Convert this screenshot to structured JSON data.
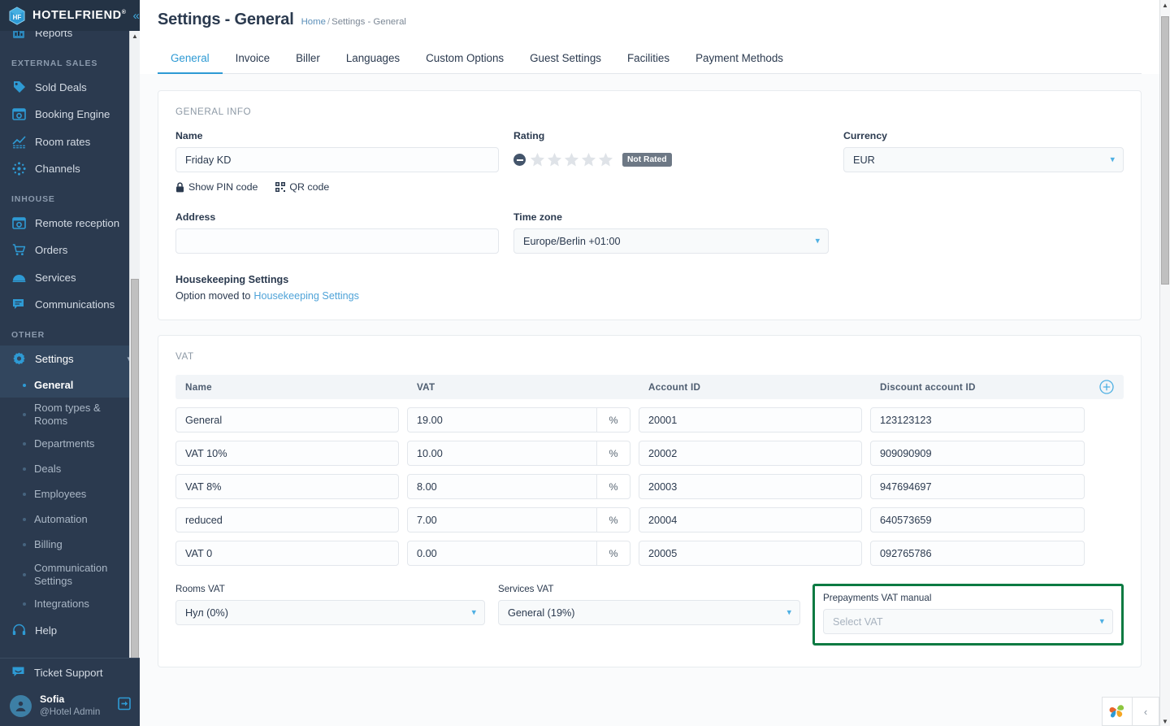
{
  "brand": {
    "name": "HOTELFRIEND",
    "trademark": "®",
    "collapse_icon": "chevron-double-left"
  },
  "sidebar": {
    "top_cut_item": {
      "label": "Reports",
      "icon": "reports-icon"
    },
    "groups": [
      {
        "title": "EXTERNAL SALES",
        "items": [
          {
            "label": "Sold Deals",
            "icon": "tag-icon"
          },
          {
            "label": "Booking Engine",
            "icon": "booking-engine-icon"
          },
          {
            "label": "Room rates",
            "icon": "chart-up-icon"
          },
          {
            "label": "Channels",
            "icon": "network-icon"
          }
        ]
      },
      {
        "title": "INHOUSE",
        "items": [
          {
            "label": "Remote reception",
            "icon": "remote-reception-icon"
          },
          {
            "label": "Orders",
            "icon": "cart-icon"
          },
          {
            "label": "Services",
            "icon": "service-dome-icon"
          },
          {
            "label": "Communications",
            "icon": "chat-icon"
          }
        ]
      },
      {
        "title": "OTHER",
        "items": [
          {
            "label": "Settings",
            "icon": "gear-icon",
            "expanded": true,
            "chevron": "chevron-down-icon"
          }
        ]
      }
    ],
    "settings_children": [
      {
        "label": "General",
        "selected": true
      },
      {
        "label": "Room types & Rooms",
        "selected": false
      },
      {
        "label": "Departments",
        "selected": false
      },
      {
        "label": "Deals",
        "selected": false
      },
      {
        "label": "Employees",
        "selected": false
      },
      {
        "label": "Automation",
        "selected": false
      },
      {
        "label": "Billing",
        "selected": false
      },
      {
        "label": "Communication Settings",
        "selected": false
      },
      {
        "label": "Integrations",
        "selected": false
      }
    ],
    "help": {
      "label": "Help",
      "icon": "headset-icon"
    },
    "ticket_support": {
      "label": "Ticket Support",
      "icon": "ticket-chat-icon"
    },
    "user": {
      "name": "Sofia",
      "role": "@Hotel Admin",
      "logout_icon": "logout-icon",
      "avatar_icon": "user-avatar-icon"
    }
  },
  "header": {
    "title": "Settings - General",
    "breadcrumb": {
      "home": "Home",
      "sep": "/",
      "current": "Settings - General"
    }
  },
  "tabs": [
    {
      "label": "General",
      "active": true
    },
    {
      "label": "Invoice",
      "active": false
    },
    {
      "label": "Biller",
      "active": false
    },
    {
      "label": "Languages",
      "active": false
    },
    {
      "label": "Custom Options",
      "active": false
    },
    {
      "label": "Guest Settings",
      "active": false
    },
    {
      "label": "Facilities",
      "active": false
    },
    {
      "label": "Payment Methods",
      "active": false
    }
  ],
  "general_info": {
    "caption": "GENERAL INFO",
    "name": {
      "label": "Name",
      "value": "Friday KD",
      "placeholder": ""
    },
    "rating": {
      "label": "Rating",
      "stars_total": 5,
      "stars_filled": 0,
      "badge": "Not Rated"
    },
    "currency": {
      "label": "Currency",
      "value": "EUR"
    },
    "show_pin": {
      "label": "Show PIN code",
      "icon": "lock-icon"
    },
    "qr_code": {
      "label": "QR code",
      "icon": "qr-code-icon"
    },
    "address": {
      "label": "Address",
      "value": "",
      "placeholder": ""
    },
    "timezone": {
      "label": "Time zone",
      "value": "Europe/Berlin +01:00"
    },
    "housekeeping": {
      "title": "Housekeeping Settings",
      "text": "Option moved to",
      "link": "Housekeeping Settings"
    }
  },
  "vat_section": {
    "caption": "VAT",
    "add_icon": "plus-circle-icon",
    "columns": [
      "Name",
      "VAT",
      "Account ID",
      "Discount account ID"
    ],
    "percent_suffix": "%",
    "rows": [
      {
        "name": "General",
        "vat": "19.00",
        "account_id": "20001",
        "discount_account_id": "123123123"
      },
      {
        "name": "VAT 10%",
        "vat": "10.00",
        "account_id": "20002",
        "discount_account_id": "909090909"
      },
      {
        "name": "VAT 8%",
        "vat": "8.00",
        "account_id": "20003",
        "discount_account_id": "947694697"
      },
      {
        "name": "reduced",
        "vat": "7.00",
        "account_id": "20004",
        "discount_account_id": "640573659"
      },
      {
        "name": "VAT 0",
        "vat": "0.00",
        "account_id": "20005",
        "discount_account_id": "092765786"
      }
    ],
    "rooms_vat": {
      "label": "Rooms VAT",
      "value": "Нул (0%)"
    },
    "services_vat": {
      "label": "Services VAT",
      "value": "General (19%)"
    },
    "prepayments_vat": {
      "label": "Prepayments VAT manual",
      "value": "",
      "placeholder": "Select VAT",
      "highlight_color": "#0b7a42"
    }
  },
  "floating_widget": {
    "logo_icon": "pinwheel-logo-icon",
    "collapse_icon": "chevron-left-icon"
  },
  "colors": {
    "accent": "#2e9ad4",
    "sidebar_bg": "#2b3a4f",
    "highlight_green": "#0b7a42"
  }
}
